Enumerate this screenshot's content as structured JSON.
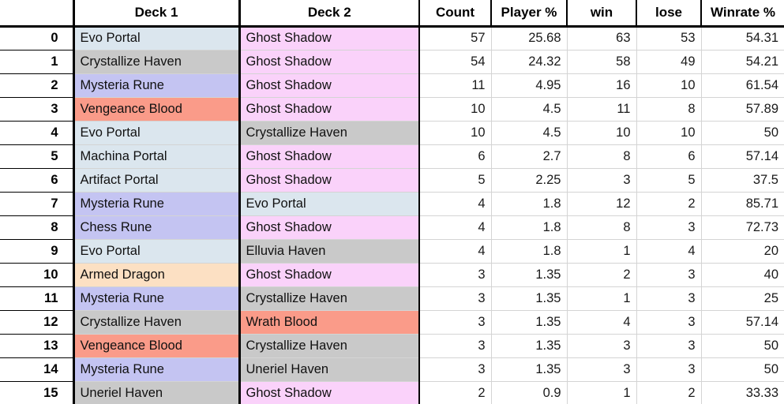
{
  "table": {
    "columns": [
      {
        "key": "index",
        "label": "",
        "align": "right"
      },
      {
        "key": "deck1",
        "label": "Deck 1",
        "align": "left"
      },
      {
        "key": "deck2",
        "label": "Deck 2",
        "align": "left"
      },
      {
        "key": "count",
        "label": "Count",
        "align": "right"
      },
      {
        "key": "player",
        "label": "Player %",
        "align": "right"
      },
      {
        "key": "win",
        "label": "win",
        "align": "right"
      },
      {
        "key": "lose",
        "label": "lose",
        "align": "right"
      },
      {
        "key": "winrate",
        "label": "Winrate %",
        "align": "right"
      }
    ],
    "archetype_colors": {
      "portal": "#dbe6ee",
      "shadow": "#fad2fa",
      "haven": "#c9c9c9",
      "rune": "#c4c4f2",
      "blood": "#fa9b89",
      "dragon": "#fce0c3"
    },
    "rows": [
      {
        "index": "0",
        "deck1": "Evo Portal",
        "deck1_class": "portal",
        "deck2": "Ghost Shadow",
        "deck2_class": "shadow",
        "count": "57",
        "player": "25.68",
        "win": "63",
        "lose": "53",
        "winrate": "54.31"
      },
      {
        "index": "1",
        "deck1": "Crystallize Haven",
        "deck1_class": "haven",
        "deck2": "Ghost Shadow",
        "deck2_class": "shadow",
        "count": "54",
        "player": "24.32",
        "win": "58",
        "lose": "49",
        "winrate": "54.21"
      },
      {
        "index": "2",
        "deck1": "Mysteria Rune",
        "deck1_class": "rune",
        "deck2": "Ghost Shadow",
        "deck2_class": "shadow",
        "count": "11",
        "player": "4.95",
        "win": "16",
        "lose": "10",
        "winrate": "61.54"
      },
      {
        "index": "3",
        "deck1": "Vengeance Blood",
        "deck1_class": "blood",
        "deck2": "Ghost Shadow",
        "deck2_class": "shadow",
        "count": "10",
        "player": "4.5",
        "win": "11",
        "lose": "8",
        "winrate": "57.89"
      },
      {
        "index": "4",
        "deck1": "Evo Portal",
        "deck1_class": "portal",
        "deck2": "Crystallize Haven",
        "deck2_class": "haven",
        "count": "10",
        "player": "4.5",
        "win": "10",
        "lose": "10",
        "winrate": "50"
      },
      {
        "index": "5",
        "deck1": "Machina Portal",
        "deck1_class": "portal",
        "deck2": "Ghost Shadow",
        "deck2_class": "shadow",
        "count": "6",
        "player": "2.7",
        "win": "8",
        "lose": "6",
        "winrate": "57.14"
      },
      {
        "index": "6",
        "deck1": "Artifact Portal",
        "deck1_class": "portal",
        "deck2": "Ghost Shadow",
        "deck2_class": "shadow",
        "count": "5",
        "player": "2.25",
        "win": "3",
        "lose": "5",
        "winrate": "37.5"
      },
      {
        "index": "7",
        "deck1": "Mysteria Rune",
        "deck1_class": "rune",
        "deck2": "Evo Portal",
        "deck2_class": "portal",
        "count": "4",
        "player": "1.8",
        "win": "12",
        "lose": "2",
        "winrate": "85.71"
      },
      {
        "index": "8",
        "deck1": "Chess Rune",
        "deck1_class": "rune",
        "deck2": "Ghost Shadow",
        "deck2_class": "shadow",
        "count": "4",
        "player": "1.8",
        "win": "8",
        "lose": "3",
        "winrate": "72.73"
      },
      {
        "index": "9",
        "deck1": "Evo Portal",
        "deck1_class": "portal",
        "deck2": "Elluvia Haven",
        "deck2_class": "haven",
        "count": "4",
        "player": "1.8",
        "win": "1",
        "lose": "4",
        "winrate": "20"
      },
      {
        "index": "10",
        "deck1": "Armed Dragon",
        "deck1_class": "dragon",
        "deck2": "Ghost Shadow",
        "deck2_class": "shadow",
        "count": "3",
        "player": "1.35",
        "win": "2",
        "lose": "3",
        "winrate": "40"
      },
      {
        "index": "11",
        "deck1": "Mysteria Rune",
        "deck1_class": "rune",
        "deck2": "Crystallize Haven",
        "deck2_class": "haven",
        "count": "3",
        "player": "1.35",
        "win": "1",
        "lose": "3",
        "winrate": "25"
      },
      {
        "index": "12",
        "deck1": "Crystallize Haven",
        "deck1_class": "haven",
        "deck2": "Wrath Blood",
        "deck2_class": "blood",
        "count": "3",
        "player": "1.35",
        "win": "4",
        "lose": "3",
        "winrate": "57.14"
      },
      {
        "index": "13",
        "deck1": "Vengeance Blood",
        "deck1_class": "blood",
        "deck2": "Crystallize Haven",
        "deck2_class": "haven",
        "count": "3",
        "player": "1.35",
        "win": "3",
        "lose": "3",
        "winrate": "50"
      },
      {
        "index": "14",
        "deck1": "Mysteria Rune",
        "deck1_class": "rune",
        "deck2": "Uneriel Haven",
        "deck2_class": "haven",
        "count": "3",
        "player": "1.35",
        "win": "3",
        "lose": "3",
        "winrate": "50"
      },
      {
        "index": "15",
        "deck1": "Uneriel Haven",
        "deck1_class": "haven",
        "deck2": "Ghost Shadow",
        "deck2_class": "shadow",
        "count": "2",
        "player": "0.9",
        "win": "1",
        "lose": "2",
        "winrate": "33.33"
      }
    ]
  }
}
